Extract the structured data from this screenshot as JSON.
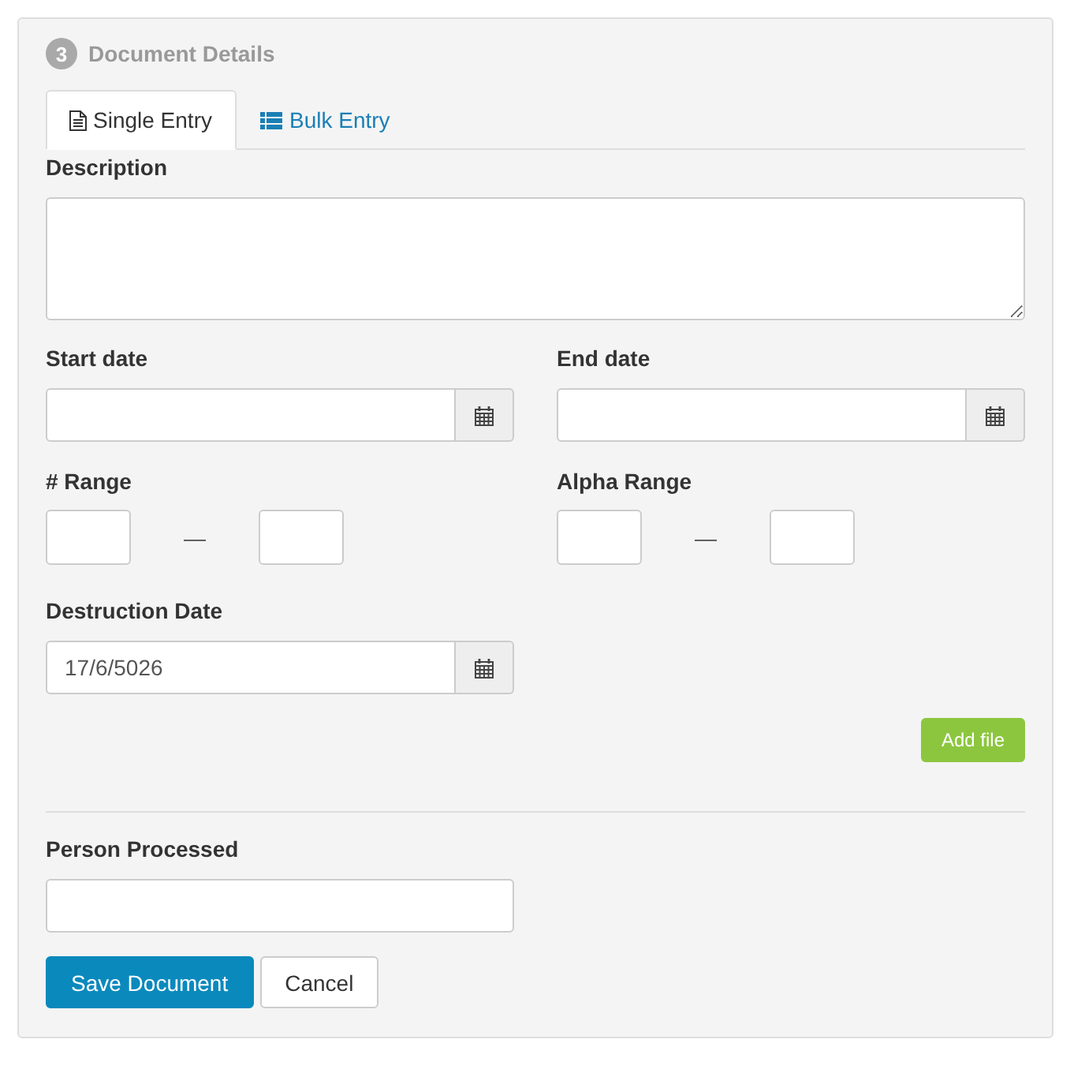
{
  "section": {
    "step": "3",
    "title": "Document Details"
  },
  "tabs": [
    {
      "label": "Single Entry",
      "selected": true
    },
    {
      "label": "Bulk Entry",
      "selected": false
    }
  ],
  "description": {
    "label": "Description"
  },
  "dates": [
    {
      "label": "Start date"
    },
    {
      "label": "End date"
    }
  ],
  "ranges": [
    {
      "label": "# Range",
      "separator": "—"
    },
    {
      "label": "Alpha Range",
      "separator": "—"
    }
  ],
  "destruction_date": {
    "label": "Destruction Date",
    "value": "17/6/5026"
  },
  "add_file_button": {
    "label": "Add file"
  },
  "person_processed": {
    "label": "Person Processed"
  },
  "actions": [
    {
      "label": "Save Document",
      "kind": "primary"
    },
    {
      "label": "Cancel",
      "kind": "default"
    }
  ]
}
